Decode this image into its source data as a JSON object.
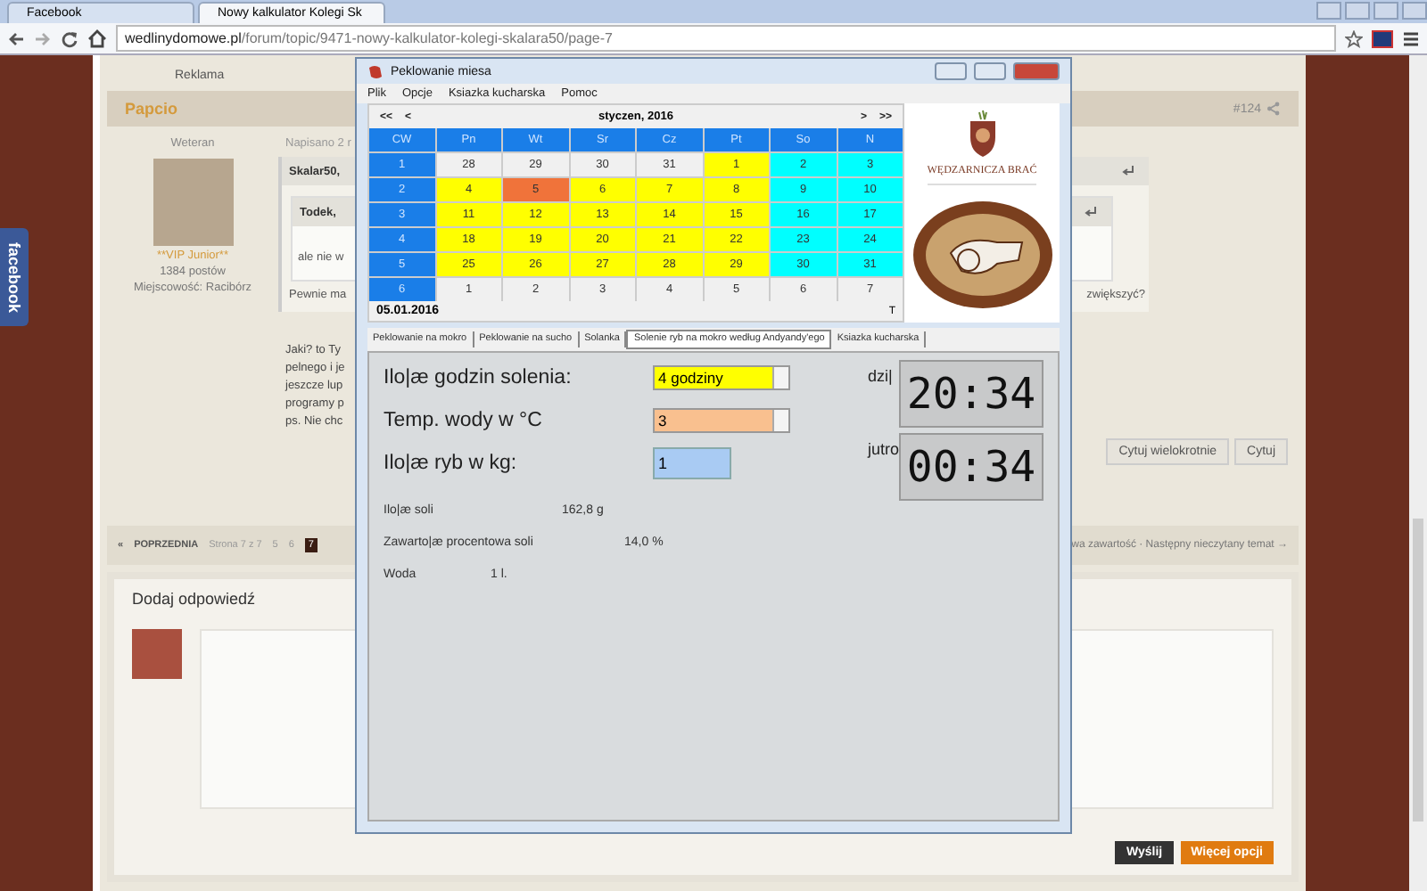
{
  "browser": {
    "tabs": [
      {
        "title": "Facebook",
        "selected": false
      },
      {
        "title": "Nowy kalkulator Kolegi Sk",
        "selected": true
      }
    ],
    "url_host": "wedlinydomowe.pl",
    "url_path": "/forum/topic/9471-nowy-kalkulator-kolegi-skalara50/page-7"
  },
  "side_tab": "facebook",
  "forum": {
    "ad_label": "Reklama",
    "post": {
      "author": "Papcio",
      "number": "#124",
      "rank": "Weteran",
      "group": "**VIP Junior**",
      "posts": "1384 postów",
      "location": "Miejscowość: Racibórz",
      "date": "Napisano 2 r",
      "quote_author": "Skalar50,",
      "inner_quote_author": "Todek,",
      "inner_quote_text": "ale nie w",
      "quote_text": "Pewnie ma",
      "quote_text_end": "zwiększyć?",
      "body_lines": [
        "Jaki? to Ty",
        "pelnego i je",
        "jeszcze lup",
        "programy p",
        "ps. Nie chc"
      ],
      "buttons": [
        "Cytuj wielokrotnie",
        "Cytuj"
      ]
    },
    "pagination": {
      "prev_arrow": "«",
      "prev": "POPRZEDNIA",
      "page_info": "Strona 7 z 7",
      "pages": [
        {
          "label": "5",
          "selected": false
        },
        {
          "label": "6",
          "selected": false
        },
        {
          "label": "7",
          "selected": true
        }
      ],
      "next_links": "wa zawartość · Następny nieczytany temat →"
    },
    "reply": {
      "title": "Dodaj odpowiedź",
      "buttons": [
        {
          "label": "Wyślij",
          "kind": "dark"
        },
        {
          "label": "Więcej opcji",
          "kind": "accent"
        }
      ]
    }
  },
  "app": {
    "title": "Peklowanie miesa",
    "menu": [
      "Plik",
      "Opcje",
      "Ksiazka kucharska",
      "Pomoc"
    ],
    "calendar": {
      "nav_left": [
        "<<",
        "<"
      ],
      "month": "styczen, 2016",
      "nav_right": [
        ">",
        ">>"
      ],
      "columns": [
        "CW",
        "Pn",
        "Wt",
        "Sr",
        "Cz",
        "Pt",
        "So",
        "N"
      ],
      "weeks": [
        {
          "week": "1",
          "days": [
            {
              "day": "28",
              "kind": "other",
              "selected": false
            },
            {
              "day": "29",
              "kind": "other",
              "selected": false
            },
            {
              "day": "30",
              "kind": "other",
              "selected": false
            },
            {
              "day": "31",
              "kind": "other",
              "selected": false
            },
            {
              "day": "1",
              "kind": "weekday",
              "selected": false
            },
            {
              "day": "2",
              "kind": "weekend",
              "selected": false
            },
            {
              "day": "3",
              "kind": "weekend",
              "selected": false
            }
          ]
        },
        {
          "week": "2",
          "days": [
            {
              "day": "4",
              "kind": "weekday",
              "selected": false
            },
            {
              "day": "5",
              "kind": "weekday",
              "selected": true
            },
            {
              "day": "6",
              "kind": "weekday",
              "selected": false
            },
            {
              "day": "7",
              "kind": "weekday",
              "selected": false
            },
            {
              "day": "8",
              "kind": "weekday",
              "selected": false
            },
            {
              "day": "9",
              "kind": "weekend",
              "selected": false
            },
            {
              "day": "10",
              "kind": "weekend",
              "selected": false
            }
          ]
        },
        {
          "week": "3",
          "days": [
            {
              "day": "11",
              "kind": "weekday",
              "selected": false
            },
            {
              "day": "12",
              "kind": "weekday",
              "selected": false
            },
            {
              "day": "13",
              "kind": "weekday",
              "selected": false
            },
            {
              "day": "14",
              "kind": "weekday",
              "selected": false
            },
            {
              "day": "15",
              "kind": "weekday",
              "selected": false
            },
            {
              "day": "16",
              "kind": "weekend",
              "selected": false
            },
            {
              "day": "17",
              "kind": "weekend",
              "selected": false
            }
          ]
        },
        {
          "week": "4",
          "days": [
            {
              "day": "18",
              "kind": "weekday",
              "selected": false
            },
            {
              "day": "19",
              "kind": "weekday",
              "selected": false
            },
            {
              "day": "20",
              "kind": "weekday",
              "selected": false
            },
            {
              "day": "21",
              "kind": "weekday",
              "selected": false
            },
            {
              "day": "22",
              "kind": "weekday",
              "selected": false
            },
            {
              "day": "23",
              "kind": "weekend",
              "selected": false
            },
            {
              "day": "24",
              "kind": "weekend",
              "selected": false
            }
          ]
        },
        {
          "week": "5",
          "days": [
            {
              "day": "25",
              "kind": "weekday",
              "selected": false
            },
            {
              "day": "26",
              "kind": "weekday",
              "selected": false
            },
            {
              "day": "27",
              "kind": "weekday",
              "selected": false
            },
            {
              "day": "28",
              "kind": "weekday",
              "selected": false
            },
            {
              "day": "29",
              "kind": "weekday",
              "selected": false
            },
            {
              "day": "30",
              "kind": "weekend",
              "selected": false
            },
            {
              "day": "31",
              "kind": "weekend",
              "selected": false
            }
          ]
        },
        {
          "week": "6",
          "days": [
            {
              "day": "1",
              "kind": "other",
              "selected": false
            },
            {
              "day": "2",
              "kind": "other",
              "selected": false
            },
            {
              "day": "3",
              "kind": "other",
              "selected": false
            },
            {
              "day": "4",
              "kind": "other",
              "selected": false
            },
            {
              "day": "5",
              "kind": "other",
              "selected": false
            },
            {
              "day": "6",
              "kind": "other",
              "selected": false
            },
            {
              "day": "7",
              "kind": "other",
              "selected": false
            }
          ]
        }
      ],
      "date": "05.01.2016",
      "today_mark": "T"
    },
    "logo_text": "WĘDZARNICZA BRAĆ",
    "tabs": [
      {
        "label": "Peklowanie na mokro",
        "selected": false
      },
      {
        "label": "Peklowanie na sucho",
        "selected": false
      },
      {
        "label": "Solanka",
        "selected": false
      },
      {
        "label": "Solenie ryb na mokro według Andyandy'ego",
        "selected": true
      },
      {
        "label": "Ksiazka kucharska",
        "selected": false
      }
    ],
    "fields": [
      {
        "label": "Ilo|æ godzin solenia:",
        "value": "4 godziny",
        "kind": "dropdown",
        "color": "#ffff00"
      },
      {
        "label": "Temp. wody w °C",
        "value": "3",
        "kind": "dropdown",
        "color": "#f9c08f"
      },
      {
        "label": "Ilo|æ ryb w kg:",
        "value": "1",
        "kind": "input",
        "color": "#a9cbf3"
      }
    ],
    "clocks": [
      {
        "label": "dzi|",
        "time": "20:34"
      },
      {
        "label": "jutro",
        "time": "00:34"
      }
    ],
    "results": [
      {
        "label": "Ilo|æ soli",
        "value": "162,8 g"
      },
      {
        "label": "Zawarto|æ procentowa soli",
        "value": "14,0 %"
      },
      {
        "label": "Woda",
        "value": "1 l."
      }
    ]
  }
}
